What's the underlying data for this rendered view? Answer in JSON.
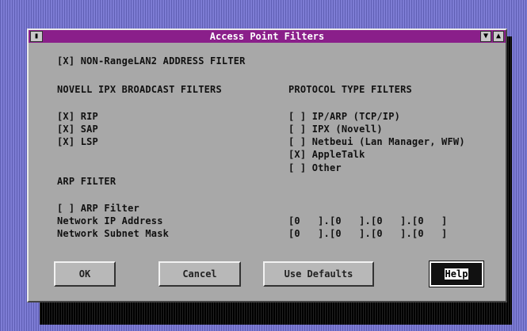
{
  "window": {
    "title": "Access Point Filters",
    "sysmenu_glyph": "▮",
    "scroll_down_glyph": "▼",
    "scroll_up_glyph": "▲"
  },
  "nonrangelan": "[X] NON-RangeLAN2 ADDRESS FILTER",
  "novell": {
    "heading": "NOVELL IPX BROADCAST FILTERS",
    "items": [
      "[X] RIP",
      "[X] SAP",
      "[X] LSP"
    ]
  },
  "protocol": {
    "heading": "PROTOCOL TYPE FILTERS",
    "items": [
      "[ ] IP/ARP (TCP/IP)",
      "[ ] IPX (Novell)",
      "[ ] Netbeui (Lan Manager, WFW)",
      "[X] AppleTalk",
      "[ ] Other"
    ]
  },
  "arp": {
    "heading": "ARP FILTER",
    "checkbox": "[ ] ARP Filter",
    "ip_label": "Network IP Address",
    "ip_value": "[0   ].[0   ].[0   ].[0   ]",
    "mask_label": "Network Subnet Mask",
    "mask_value": "[0   ].[0   ].[0   ].[0   ]"
  },
  "buttons": {
    "ok": "OK",
    "cancel": "Cancel",
    "defaults": "Use Defaults",
    "help": "Help"
  }
}
